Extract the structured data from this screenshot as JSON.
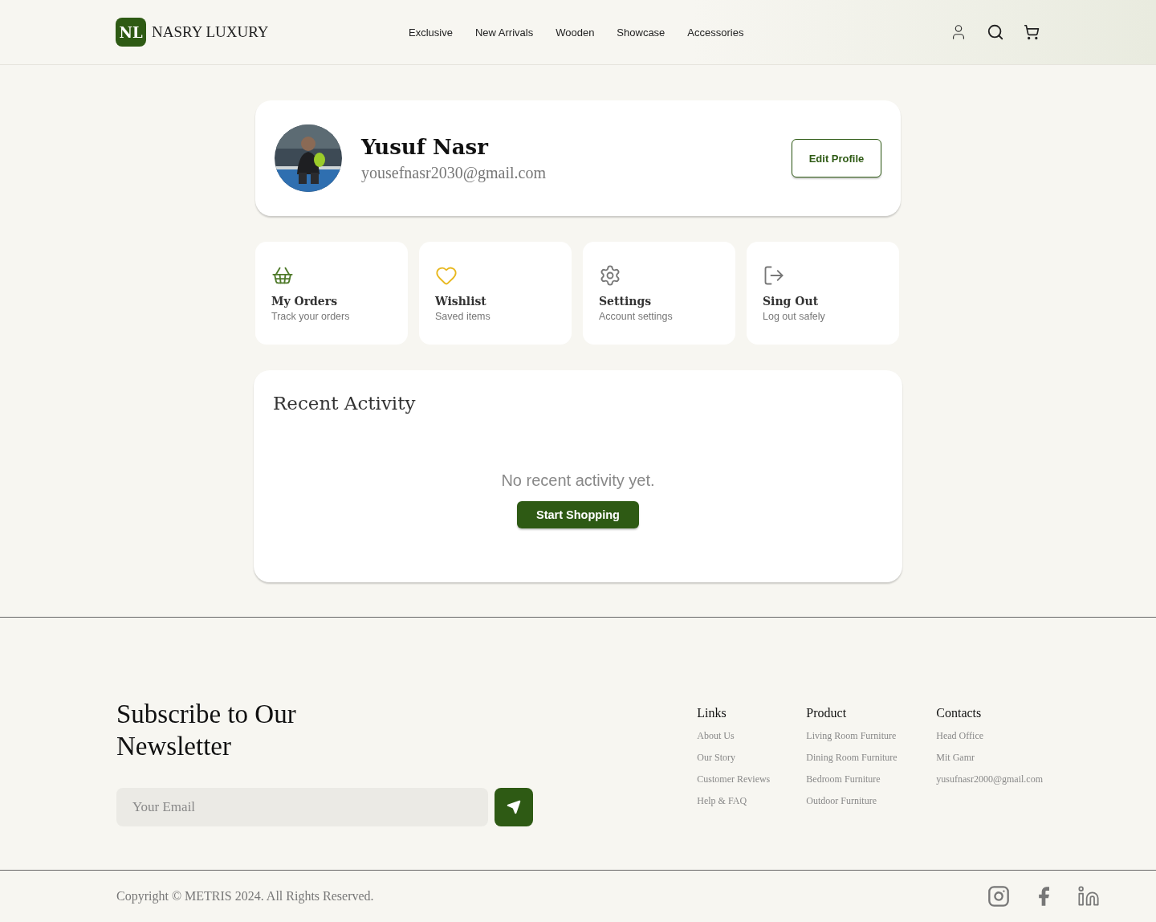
{
  "brand": {
    "mark": "NL",
    "name": "NASRY LUXURY"
  },
  "nav": [
    "Exclusive",
    "New Arrivals",
    "Wooden",
    "Showcase",
    "Accessories"
  ],
  "profile": {
    "name": "Yusuf Nasr",
    "email": "yousefnasr2030@gmail.com",
    "edit_button": "Edit Profile"
  },
  "tiles": [
    {
      "kind": "orders",
      "title": "My Orders",
      "subtitle": "Track your orders"
    },
    {
      "kind": "wishlist",
      "title": "Wishlist",
      "subtitle": "Saved items"
    },
    {
      "kind": "settings",
      "title": "Settings",
      "subtitle": "Account settings"
    },
    {
      "kind": "logout",
      "title": "Sing Out",
      "subtitle": "Log out safely"
    }
  ],
  "activity": {
    "title": "Recent Activity",
    "empty_message": "No recent activity yet.",
    "button": "Start Shopping"
  },
  "newsletter": {
    "title": "Subscribe to Our Newsletter",
    "placeholder": "Your Email"
  },
  "footer_columns": [
    {
      "heading": "Links",
      "items": [
        "About Us",
        "Our Story",
        "Customer Reviews",
        "Help & FAQ"
      ]
    },
    {
      "heading": "Product",
      "items": [
        "Living Room Furniture",
        "Dining Room Furniture",
        "Bedroom Furniture",
        "Outdoor Furniture"
      ]
    },
    {
      "heading": "Contacts",
      "items": [
        "Head Office",
        "Mit Gamr",
        "yusufnasr2000@gmail.com"
      ]
    }
  ],
  "copyright": "Copyright © METRIS 2024. All Rights Reserved."
}
